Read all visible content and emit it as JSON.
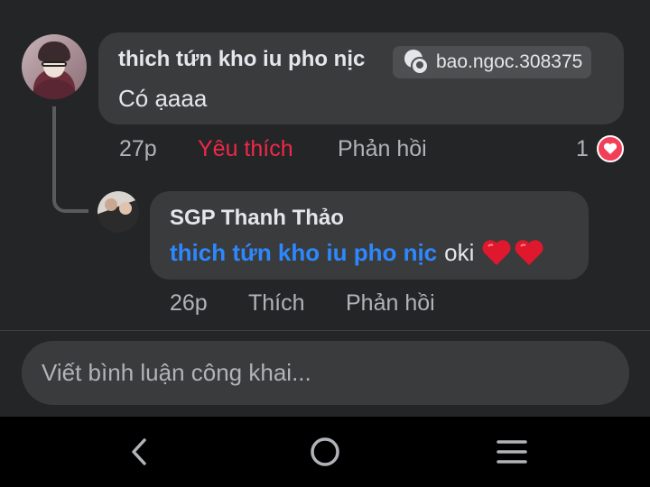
{
  "comment": {
    "author": "thich tứn kho iu pho nịc",
    "tag_label": "bao.ngoc.308375",
    "text": "Có ạaaa",
    "time": "27p",
    "like_label": "Yêu thích",
    "reply_label": "Phản hồi",
    "reaction_count": "1",
    "reaction_icon": "heart-icon"
  },
  "reply": {
    "author": "SGP Thanh Thảo",
    "mention": "thich tứn kho iu pho nịc",
    "text": "oki",
    "emoji": [
      "heart-emoji",
      "heart-emoji"
    ],
    "time": "26p",
    "like_label": "Thích",
    "reply_label": "Phản hồi"
  },
  "composer": {
    "placeholder": "Viết bình luận công khai..."
  },
  "navbar": {
    "icons": [
      "back-icon",
      "home-icon",
      "recent-apps-icon"
    ]
  },
  "colors": {
    "background": "#242526",
    "bubble": "#3a3b3c",
    "love_accent": "#f0284a",
    "mention": "#2d88ff",
    "heart": "#f33e58"
  }
}
